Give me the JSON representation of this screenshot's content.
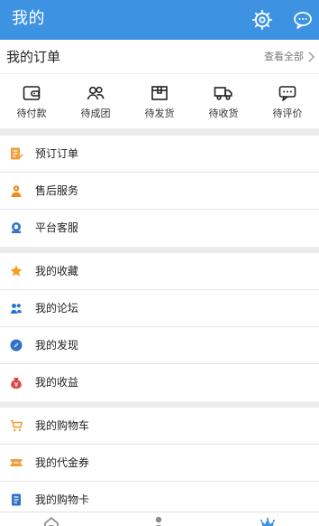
{
  "header": {
    "title": "我的",
    "settings_icon": "settings-gear-icon",
    "message_icon": "message-bubble-icon",
    "background_color": "#3d93e2",
    "text_color": "#ffffff"
  },
  "orders": {
    "title": "我的订单",
    "view_all_label": "查看全部",
    "view_all_icon": "chevron-right-icon",
    "statuses": [
      {
        "label": "待付款",
        "icon": "wallet-icon"
      },
      {
        "label": "待成团",
        "icon": "group-icon"
      },
      {
        "label": "待发货",
        "icon": "box-icon"
      },
      {
        "label": "待收货",
        "icon": "truck-icon"
      },
      {
        "label": "待评价",
        "icon": "comment-icon"
      }
    ]
  },
  "sections": [
    {
      "name": "service-section",
      "items": [
        {
          "label": "预订订单",
          "icon": "reservation-icon",
          "color": "#f29d38"
        },
        {
          "label": "售后服务",
          "icon": "after-sales-icon",
          "color": "#f08a18"
        },
        {
          "label": "平台客服",
          "icon": "customer-service-icon",
          "color": "#2d73c8"
        }
      ]
    },
    {
      "name": "social-section",
      "items": [
        {
          "label": "我的收藏",
          "icon": "star-icon",
          "color": "#f59b1e"
        },
        {
          "label": "我的论坛",
          "icon": "forum-icon",
          "color": "#2d73c8"
        },
        {
          "label": "我的发现",
          "icon": "discover-icon",
          "color": "#2d73c8"
        },
        {
          "label": "我的收益",
          "icon": "earnings-icon",
          "color": "#e2433d"
        }
      ]
    },
    {
      "name": "shopping-section",
      "items": [
        {
          "label": "我的购物车",
          "icon": "cart-icon",
          "color": "#f29d38"
        },
        {
          "label": "我的代金券",
          "icon": "voucher-icon",
          "color": "#f29d38"
        },
        {
          "label": "我的购物卡",
          "icon": "card-icon",
          "color": "#2d73c8"
        }
      ]
    }
  ],
  "bottom_nav": {
    "items": [
      {
        "icon": "home-icon"
      },
      {
        "icon": "user-icon"
      },
      {
        "icon": "crown-icon",
        "active": true
      }
    ],
    "active_color": "#3d93e2",
    "inactive_color": "#8c8c8c"
  }
}
